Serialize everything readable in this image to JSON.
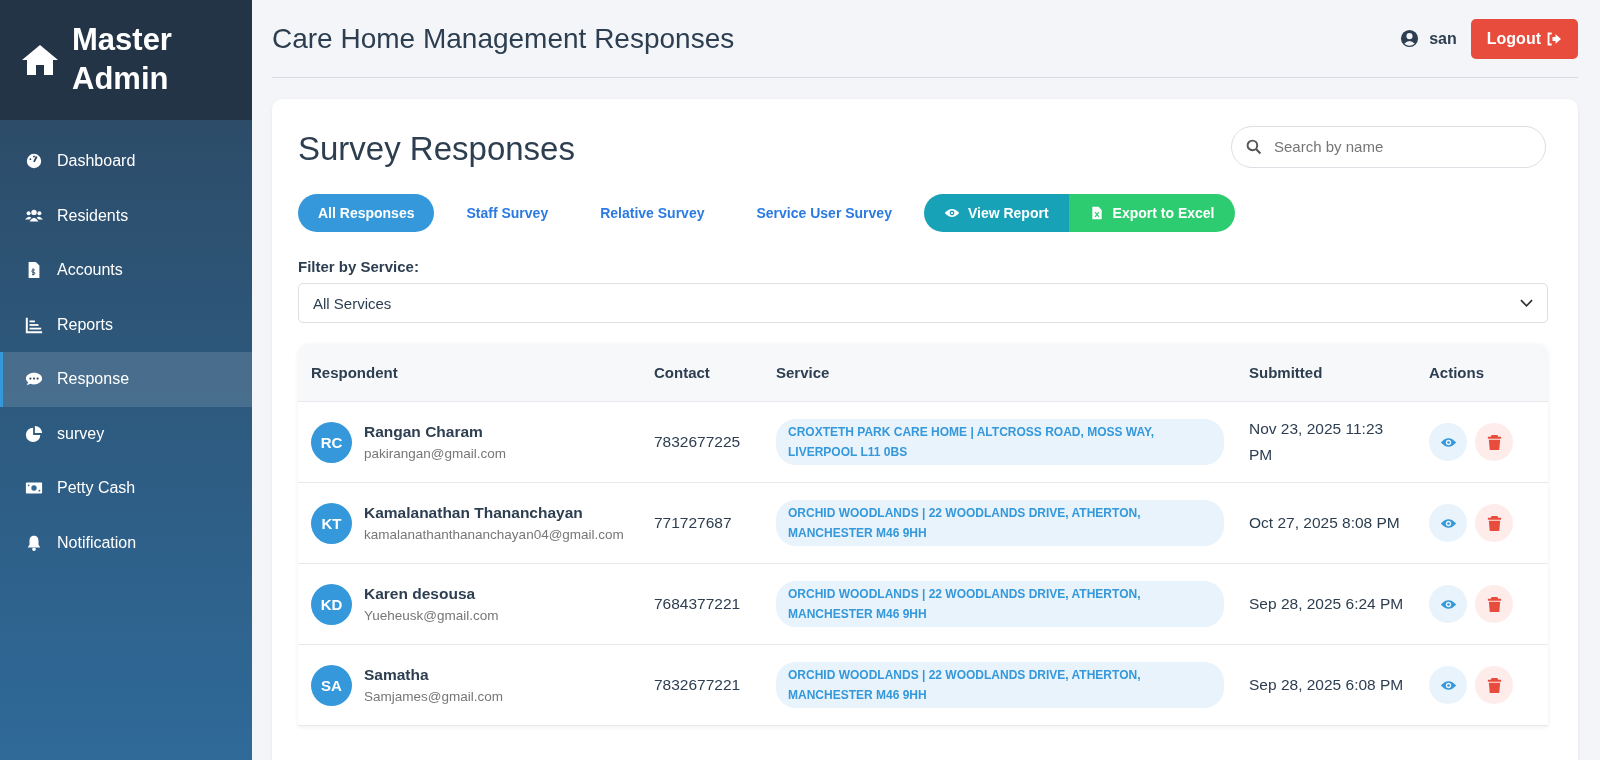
{
  "sidebar": {
    "brand": "Master Admin",
    "items": [
      {
        "label": "Dashboard",
        "selected": false
      },
      {
        "label": "Residents",
        "selected": false
      },
      {
        "label": "Accounts",
        "selected": false
      },
      {
        "label": "Reports",
        "selected": false
      },
      {
        "label": "Response",
        "selected": true
      },
      {
        "label": "survey",
        "selected": false
      },
      {
        "label": "Petty Cash",
        "selected": false
      },
      {
        "label": "Notification",
        "selected": false
      }
    ]
  },
  "header": {
    "title": "Care Home Management Responses",
    "user": "san",
    "logout": "Logout"
  },
  "card": {
    "title": "Survey Responses",
    "search": {
      "placeholder": "Search by name"
    },
    "tabs": [
      {
        "label": "All Responses",
        "selected": true
      },
      {
        "label": "Staff Survey",
        "selected": false
      },
      {
        "label": "Relative Survey",
        "selected": false
      },
      {
        "label": "Service User Survey",
        "selected": false
      }
    ],
    "actions": [
      {
        "label": "View Report",
        "kind": "report"
      },
      {
        "label": "Export to Excel",
        "kind": "export"
      }
    ],
    "filter": {
      "label": "Filter by Service:",
      "value": "All Services"
    },
    "table": {
      "columns": [
        "Respondent",
        "Contact",
        "Service",
        "Submitted",
        "Actions"
      ],
      "rows": [
        {
          "initials": "RC",
          "name": "Rangan Charam",
          "email": "pakirangan@gmail.com",
          "contact": "7832677225",
          "service": "CROXTETH PARK CARE HOME | ALTCROSS ROAD, MOSS WAY, LIVERPOOL L11 0BS",
          "submitted": "Nov 23, 2025 11:23 PM"
        },
        {
          "initials": "KT",
          "name": "Kamalanathan Thananchayan",
          "email": "kamalanathanthananchayan04@gmail.com",
          "contact": "771727687",
          "service": "ORCHID WOODLANDS | 22 WOODLANDS DRIVE, ATHERTON, MANCHESTER M46 9HH",
          "submitted": "Oct 27, 2025 8:08 PM"
        },
        {
          "initials": "KD",
          "name": "Karen desousa",
          "email": "Yueheusk@gmail.com",
          "contact": "7684377221",
          "service": "ORCHID WOODLANDS | 22 WOODLANDS DRIVE, ATHERTON, MANCHESTER M46 9HH",
          "submitted": "Sep 28, 2025 6:24 PM"
        },
        {
          "initials": "SA",
          "name": "Samatha",
          "email": "Samjames@gmail.com",
          "contact": "7832677221",
          "service": "ORCHID WOODLANDS | 22 WOODLANDS DRIVE, ATHERTON, MANCHESTER M46 9HH",
          "submitted": "Sep 28, 2025 6:08 PM"
        }
      ]
    }
  }
}
